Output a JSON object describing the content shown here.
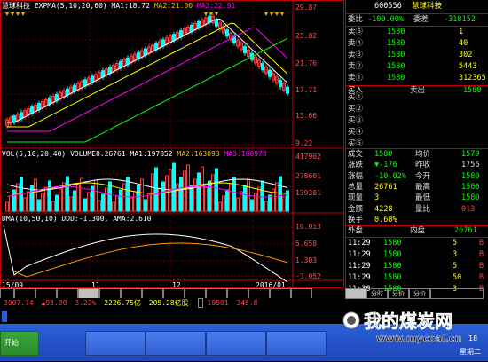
{
  "stock": {
    "code": "600556",
    "name": "慧球科技"
  },
  "chart": {
    "period_label": "",
    "expma_header": "EXPMA(5,10,20,60)",
    "ma1": "MA1:18.72",
    "ma2": "MA2:21.00",
    "ma3": "MA3:22.91",
    "price_ticks": [
      "29.87",
      "25.82",
      "21.76",
      "17.71",
      "13.66",
      "9.22"
    ],
    "vol_header": "VOL(5,10,20,40) VOLUME0:26761",
    "vol_ma1": "MA1:197852",
    "vol_ma2": "MA2:163093",
    "vol_ma3": "MA3:160978",
    "vol_ticks": [
      "417902",
      "278601",
      "139301"
    ],
    "dma_header": "DMA(10,50,10) DDD:-1.300, AMA:2.610",
    "dma_ticks": [
      "10.013",
      "5.658",
      "1.303",
      "-3.052"
    ],
    "dates": [
      "15/09",
      "11",
      "12",
      "2016/01"
    ]
  },
  "colors": {
    "up": "#ff3c3c",
    "down": "#00ffff",
    "ma1": "#ffffff",
    "ma2": "#ffff00",
    "ma3": "#ff00ff",
    "ma4": "#00ff00",
    "grid": "#800000",
    "border": "#c00000"
  },
  "orderbook": {
    "weibi_label": "委比",
    "weibi_val": "-100.00%",
    "weicha_label": "委差",
    "weicha_val": "-318152",
    "sells": [
      {
        "label": "卖⑤",
        "price": "1580",
        "vol": "1"
      },
      {
        "label": "卖④",
        "price": "1580",
        "vol": "40"
      },
      {
        "label": "卖③",
        "price": "1580",
        "vol": "302"
      },
      {
        "label": "卖②",
        "price": "1580",
        "vol": "5443"
      },
      {
        "label": "卖①",
        "price": "1580",
        "vol": "312365"
      }
    ],
    "buy_header": "买入",
    "sell_header": "卖出",
    "sell_price": "1580",
    "buys": [
      {
        "label": "买①",
        "price": "",
        "vol": ""
      },
      {
        "label": "买②",
        "price": "",
        "vol": ""
      },
      {
        "label": "买③",
        "price": "",
        "vol": ""
      },
      {
        "label": "买④",
        "price": "",
        "vol": ""
      },
      {
        "label": "买⑤",
        "price": "",
        "vol": ""
      }
    ],
    "quote": [
      {
        "l1": "成交",
        "v1": "1580",
        "l2": "均价",
        "v2": "1579"
      },
      {
        "l1": "涨跌",
        "v1": "▼-176",
        "l2": "昨收",
        "v2": "1756"
      },
      {
        "l1": "涨幅",
        "v1": "-10.02%",
        "l2": "今开",
        "v2": "1580"
      },
      {
        "l1": "总量",
        "v1": "26761",
        "l2": "最高",
        "v2": "1580"
      },
      {
        "l1": "现量",
        "v1": "3",
        "l2": "最低",
        "v2": "1580"
      },
      {
        "l1": "金额",
        "v1": "4228",
        "l2": "量比",
        "v2": "013"
      },
      {
        "l1": "换手",
        "v1": "0.68%",
        "l2": "",
        "v2": ""
      }
    ],
    "outer_label": "外盘",
    "outer_val": "",
    "inner_label": "内盘",
    "inner_val": "26761",
    "ticks": [
      {
        "time": "11:29",
        "price": "1580",
        "vol": "5",
        "flag": "B"
      },
      {
        "time": "11:29",
        "price": "1580",
        "vol": "3",
        "flag": "B"
      },
      {
        "time": "11:29",
        "price": "1580",
        "vol": "5",
        "flag": "B"
      },
      {
        "time": "11:29",
        "price": "1580",
        "vol": "50",
        "flag": "B"
      },
      {
        "time": "11:30",
        "price": "1580",
        "vol": "3",
        "flag": "B"
      }
    ]
  },
  "bottom_tabs": [
    "",
    "",
    "",
    "",
    "",
    "",
    "",
    "",
    "",
    "",
    "",
    "",
    "",
    "",
    ""
  ],
  "right_tabs": [
    "",
    "分时",
    "分价",
    "分价",
    ""
  ],
  "ticker": {
    "label": "",
    "val1": "3007.74",
    "val2": "▲93.90",
    "val3": "3.22%",
    "val4": "2226.75亿",
    "val5": "205.28亿股",
    "label2": "",
    "val6": "10501",
    "val7": "345.8"
  },
  "status_bar": {
    "connection": "",
    "marquee": ""
  },
  "taskbar": {
    "start": "开始",
    "items": [
      "",
      "",
      "",
      ""
    ],
    "clock": "18",
    "weekday": "星期二"
  },
  "watermark": {
    "title": "我的煤炭网",
    "url": "www.mycoal.cn"
  }
}
